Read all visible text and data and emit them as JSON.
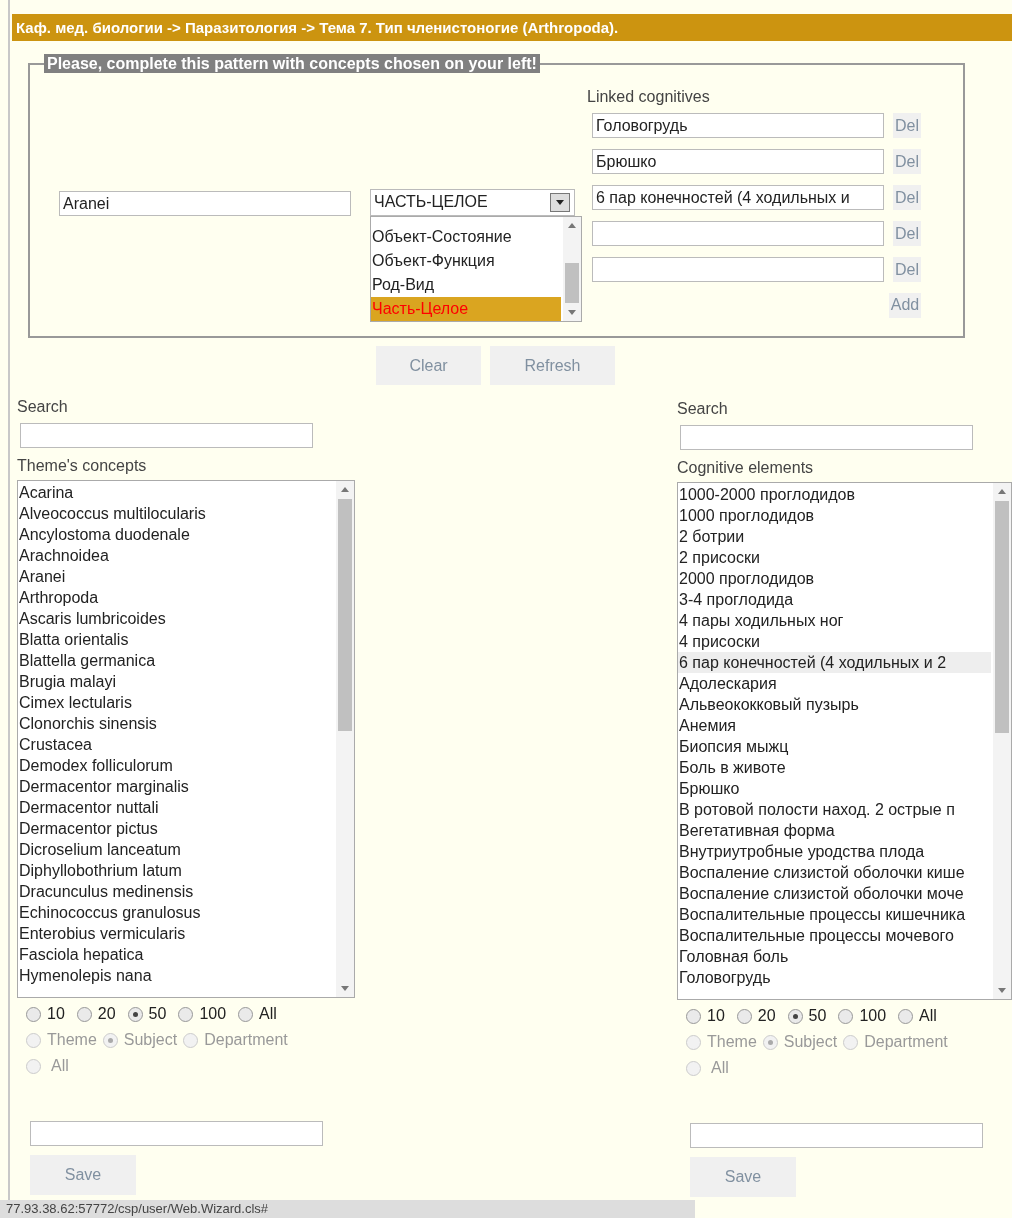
{
  "breadcrumb": "Каф. мед. биологии -> Паразитология -> Тема 7. Тип членистоногие (Arthropoda).",
  "pattern": {
    "legend": "Please, complete this pattern with concepts chosen on your left!",
    "concept": {
      "value": "Aranei"
    },
    "relation": {
      "value": "ЧАСТЬ-ЦЕЛОЕ",
      "options": [
        {
          "label": "Объект-Состояние",
          "selected": false
        },
        {
          "label": "Объект-Функция",
          "selected": false
        },
        {
          "label": "Род-Вид",
          "selected": false
        },
        {
          "label": "Часть-Целое",
          "selected": true
        }
      ]
    },
    "linked": {
      "label": "Linked cognitives",
      "fields": [
        {
          "value": "Головогрудь",
          "button": "Del"
        },
        {
          "value": "Брюшко",
          "button": "Del"
        },
        {
          "value": "6 пар конечностей (4 ходильных и",
          "button": "Del"
        },
        {
          "button": "Del"
        },
        {
          "button": "Del"
        }
      ],
      "add_button": "Add"
    }
  },
  "actions": [
    "Clear",
    "Refresh"
  ],
  "panels": [
    {
      "search_label": "Search",
      "list_label": "Theme's concepts",
      "items": [
        {
          "label": "Acarina",
          "selected": false
        },
        {
          "label": "Alveococcus multilocularis",
          "selected": false
        },
        {
          "label": "Ancylostoma duodenale",
          "selected": false
        },
        {
          "label": "Arachnoidea",
          "selected": false
        },
        {
          "label": "Aranei",
          "selected": false
        },
        {
          "label": "Arthropoda",
          "selected": false
        },
        {
          "label": "Ascaris lumbricoides",
          "selected": false
        },
        {
          "label": "Blatta orientalis",
          "selected": false
        },
        {
          "label": "Blattella germanica",
          "selected": false
        },
        {
          "label": "Brugia malayi",
          "selected": false
        },
        {
          "label": "Cimex lectularis",
          "selected": false
        },
        {
          "label": "Clonorchis sinensis",
          "selected": false
        },
        {
          "label": "Crustacea",
          "selected": false
        },
        {
          "label": "Demodex folliculorum",
          "selected": false
        },
        {
          "label": "Dermacentor marginalis",
          "selected": false
        },
        {
          "label": "Dermacentor nuttali",
          "selected": false
        },
        {
          "label": "Dermacentor pictus",
          "selected": false
        },
        {
          "label": "Dicroselium lanceatum",
          "selected": false
        },
        {
          "label": "Diphyllobothrium latum",
          "selected": false
        },
        {
          "label": "Dracunculus medinensis",
          "selected": false
        },
        {
          "label": "Echinococcus granulosus",
          "selected": false
        },
        {
          "label": "Enterobius vermicularis",
          "selected": false
        },
        {
          "label": "Fasciola hepatica",
          "selected": false
        },
        {
          "label": "Hymenolepis nana",
          "selected": false
        }
      ],
      "page_sizes": [
        {
          "label": "10",
          "selected": false
        },
        {
          "label": "20",
          "selected": false
        },
        {
          "label": "50",
          "selected": true
        },
        {
          "label": "100",
          "selected": false
        },
        {
          "label": "All",
          "selected": false
        }
      ],
      "scopes": [
        {
          "label": "Theme",
          "selected": false,
          "disabled": true
        },
        {
          "label": "Subject",
          "selected": true,
          "disabled": true
        },
        {
          "label": "Department",
          "selected": false,
          "disabled": true
        },
        {
          "label": "All",
          "selected": false,
          "disabled": true
        }
      ],
      "save_button": "Save"
    },
    {
      "search_label": "Search",
      "list_label": "Cognitive elements",
      "items": [
        {
          "label": "1000-2000 проглодидов",
          "selected": false
        },
        {
          "label": "1000 проглодидов",
          "selected": false
        },
        {
          "label": "2 ботрии",
          "selected": false
        },
        {
          "label": "2 присоски",
          "selected": false
        },
        {
          "label": "2000 проглодидов",
          "selected": false
        },
        {
          "label": "3-4 проглодида",
          "selected": false
        },
        {
          "label": "4 пары ходильных ног",
          "selected": false
        },
        {
          "label": "4 присоски",
          "selected": false
        },
        {
          "label": "6 пар конечностей (4 ходильных и 2",
          "selected": true
        },
        {
          "label": "Адолескария",
          "selected": false
        },
        {
          "label": "Альвеококковый пузырь",
          "selected": false
        },
        {
          "label": "Анемия",
          "selected": false
        },
        {
          "label": "Биопсия мыжц",
          "selected": false
        },
        {
          "label": "Боль в животе",
          "selected": false
        },
        {
          "label": "Брюшко",
          "selected": false
        },
        {
          "label": "В ротовой полости наход. 2 острые п",
          "selected": false
        },
        {
          "label": "Вегетативная форма",
          "selected": false
        },
        {
          "label": "Внутриутробные уродства плода",
          "selected": false
        },
        {
          "label": "Воспаление слизистой оболочки кише",
          "selected": false
        },
        {
          "label": "Воспаление слизистой оболочки моче",
          "selected": false
        },
        {
          "label": "Воспалительные процессы кишечника",
          "selected": false
        },
        {
          "label": "Воспалительные процессы мочевого",
          "selected": false
        },
        {
          "label": "Головная боль",
          "selected": false
        },
        {
          "label": "Головогрудь",
          "selected": false
        }
      ],
      "page_sizes": [
        {
          "label": "10",
          "selected": false
        },
        {
          "label": "20",
          "selected": false
        },
        {
          "label": "50",
          "selected": true
        },
        {
          "label": "100",
          "selected": false
        },
        {
          "label": "All",
          "selected": false
        }
      ],
      "scopes": [
        {
          "label": "Theme",
          "selected": false,
          "disabled": true
        },
        {
          "label": "Subject",
          "selected": true,
          "disabled": true
        },
        {
          "label": "Department",
          "selected": false,
          "disabled": true
        },
        {
          "label": "All",
          "selected": false,
          "disabled": true
        }
      ],
      "save_button": "Save"
    }
  ],
  "status_bar": "77.93.38.62:57772/csp/user/Web.Wizard.cls#"
}
